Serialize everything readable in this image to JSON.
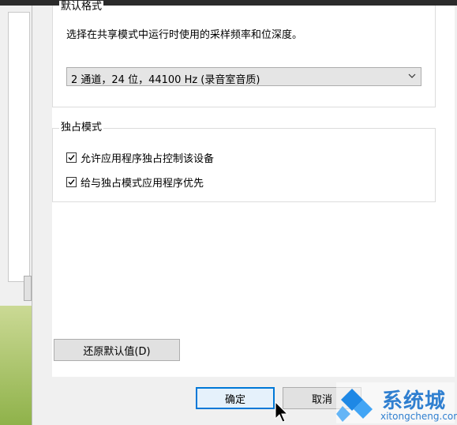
{
  "default_format": {
    "title": "默认格式",
    "description": "选择在共享模式中运行时使用的采样频率和位深度。",
    "selected_value": "2 通道，24 位，44100 Hz (录音室音质)"
  },
  "exclusive_mode": {
    "title": "独占模式",
    "allow_exclusive": {
      "label": "允许应用程序独占控制该设备",
      "checked": true
    },
    "give_priority": {
      "label": "给与独占模式应用程序优先",
      "checked": true
    }
  },
  "buttons": {
    "restore_defaults": "还原默认值(D)",
    "ok": "确定",
    "cancel": "取消"
  },
  "watermark": {
    "brand": "系统城",
    "url": "xitongcheng.com"
  },
  "colors": {
    "accent": "#0078d7",
    "watermark_blue": "#2f7fd0"
  }
}
